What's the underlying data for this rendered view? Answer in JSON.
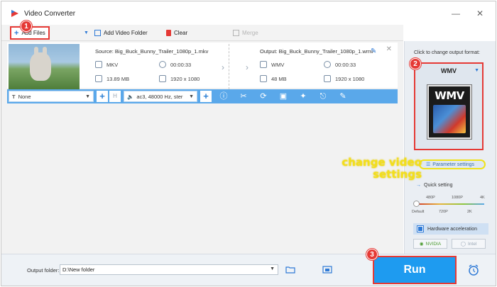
{
  "app": {
    "title": "Video Converter"
  },
  "toolbar": {
    "add_files": "Add Files",
    "add_folder": "Add Video Folder",
    "clear": "Clear",
    "merge": "Merge"
  },
  "steps": [
    "1",
    "2",
    "3"
  ],
  "file": {
    "source_label": "Source: Big_Buck_Bunny_Trailer_1080p_1.mkv",
    "source_format": "MKV",
    "source_duration": "00:00:33",
    "source_size": "13.89 MB",
    "source_resolution": "1920 x 1080",
    "output_label": "Output: Big_Buck_Bunny_Trailer_1080p_1.wmv",
    "output_format": "WMV",
    "output_duration": "00:00:33",
    "output_size": "48 MB",
    "output_resolution": "1920 x 1080"
  },
  "editbar": {
    "subtitle": "None",
    "audio": "ac3, 48000 Hz, ster"
  },
  "right_panel": {
    "prompt": "Click to change output format:",
    "format": "WMV",
    "logo_text": "WMV",
    "parameter_settings": "Parameter settings",
    "quick_setting": "Quick setting",
    "quality_top": [
      "480P",
      "1080P",
      "4K"
    ],
    "quality_bottom": [
      "Default",
      "720P",
      "2K"
    ],
    "hardware_acceleration": "Hardware acceleration",
    "nvidia": "NVIDIA",
    "intel": "Intel"
  },
  "annotation": {
    "line1": "change video",
    "line2": "settings"
  },
  "bottom": {
    "output_folder_label": "Output folder:",
    "output_folder_value": "D:\\New folder",
    "run": "Run"
  },
  "colors": {
    "accent_blue": "#1e9bf0",
    "edit_strip": "#5aa8ea",
    "highlight_red": "#e53935",
    "annotation_yellow": "#f3df1a"
  }
}
